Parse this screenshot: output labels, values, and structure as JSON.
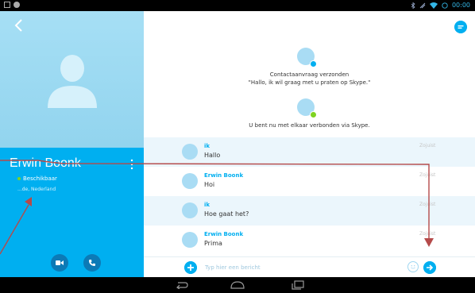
{
  "contact": {
    "name": "Erwin Boonk",
    "status": "Beschikbaar",
    "location": "...de, Nederland"
  },
  "system": {
    "request_title": "Contactaanvraag verzonden",
    "request_message": "\"Hallo, ik wil graag met u praten op Skype.\"",
    "connected": "U bent nu met elkaar verbonden via Skype."
  },
  "messages": [
    {
      "sender": "ik",
      "text": "Hallo",
      "time": "Zojuist"
    },
    {
      "sender": "Erwin Boonk",
      "text": "Hoi",
      "time": "Zojuist"
    },
    {
      "sender": "ik",
      "text": "Hoe gaat het?",
      "time": "Zojuist"
    },
    {
      "sender": "Erwin Boonk",
      "text": "Prima",
      "time": "Zojuist"
    }
  ],
  "composer": {
    "placeholder": "Typ hier een bericht"
  },
  "statusbar": {
    "clock": "00:00"
  },
  "colors": {
    "accent": "#00aff0",
    "annotation": "#b54a4a",
    "available": "#7ed321"
  },
  "icons": [
    "back-arrow-icon",
    "avatar-placeholder-icon",
    "more-vert-icon",
    "video-icon",
    "phone-icon",
    "chat-icon",
    "add-icon",
    "emoji-icon",
    "send-icon",
    "android-back-icon",
    "android-home-icon",
    "android-recents-icon",
    "wifi-icon",
    "bluetooth-icon",
    "alarm-icon"
  ]
}
